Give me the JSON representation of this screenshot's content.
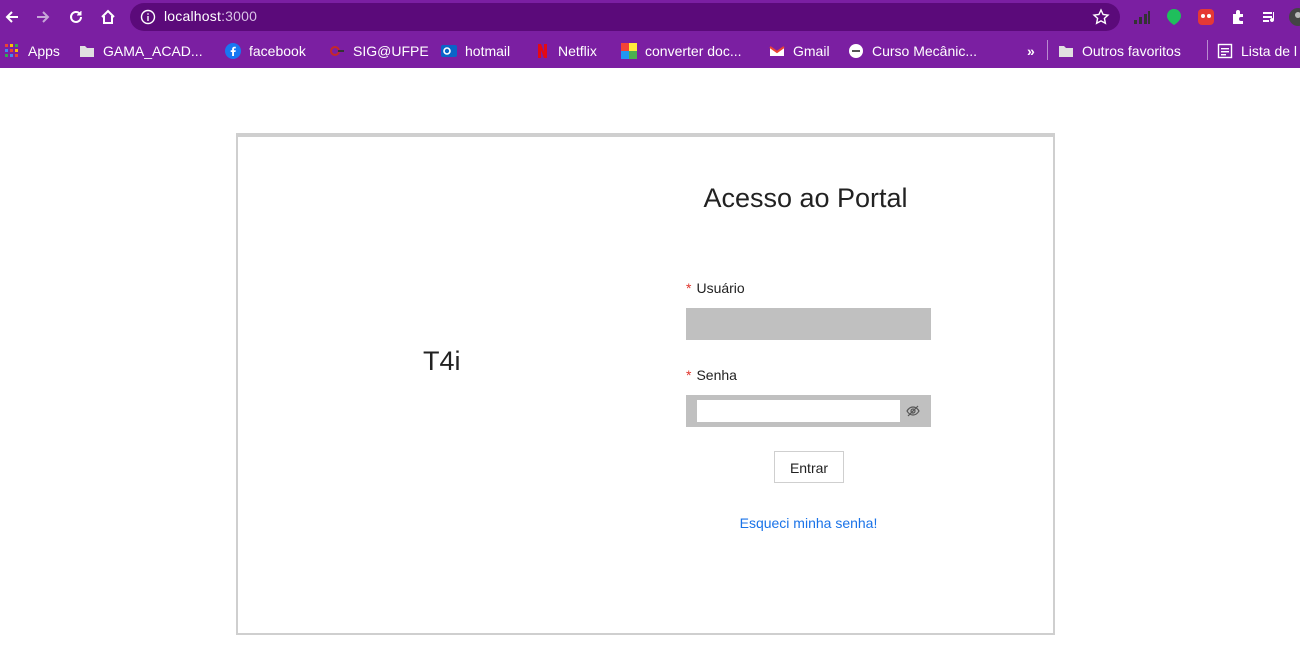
{
  "browser": {
    "url_host": "localhost",
    "url_port": ":3000",
    "toolbar_color": "#7b1fa2",
    "omnibox_color": "#5b0a7a"
  },
  "bookmarks": {
    "apps": "Apps",
    "items": [
      "GAMA_ACAD...",
      "facebook",
      "SIG@UFPE",
      "hotmail",
      "Netflix",
      "converter doc...",
      "Gmail",
      "Curso Mecânic..."
    ],
    "overflow": "»",
    "other_favorites": "Outros favoritos",
    "reading_list": "Lista de l"
  },
  "login": {
    "brand": "T4i",
    "title": "Acesso ao Portal",
    "required_mark": "*",
    "user_label": "Usuário",
    "password_label": "Senha",
    "submit": "Entrar",
    "forgot": "Esqueci minha senha!",
    "input_bg": "#c0c0c0",
    "link_color": "#1a73e8",
    "required_color": "#e0342b"
  }
}
